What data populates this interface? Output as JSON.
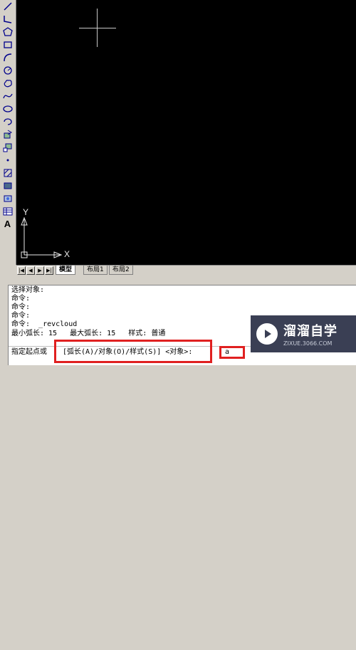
{
  "toolbar": {
    "items": [
      "line",
      "polyline",
      "polygon",
      "rectangle",
      "arc",
      "circle",
      "revision-cloud",
      "spline",
      "ellipse",
      "ellipse-arc",
      "insert-block",
      "make-block",
      "point",
      "hatch",
      "region",
      "table",
      "multiline-text"
    ],
    "text_tool_label": "A"
  },
  "canvas": {
    "ucs_y_label": "Y",
    "ucs_x_label": "X"
  },
  "tabs": {
    "items": [
      "模型",
      "布局1",
      "布局2"
    ],
    "active": "模型"
  },
  "command_window": {
    "history": [
      "选择对象:",
      "命令:",
      "命令:",
      "命令:",
      "命令:  _revcloud",
      "最小弧长: 15   最大弧长: 15   样式: 普通"
    ],
    "prompt_prefix": "指定起点或",
    "prompt_options": "[弧长(A)/对象(O)/样式(S)] <对象>:",
    "input_value": "a"
  },
  "watermark": {
    "title": "溜溜自学",
    "subtitle": "ZIXUE.3066.COM"
  },
  "colors": {
    "canvas": "#000000",
    "chrome": "#d4d0c8",
    "highlight": "#e02020"
  }
}
